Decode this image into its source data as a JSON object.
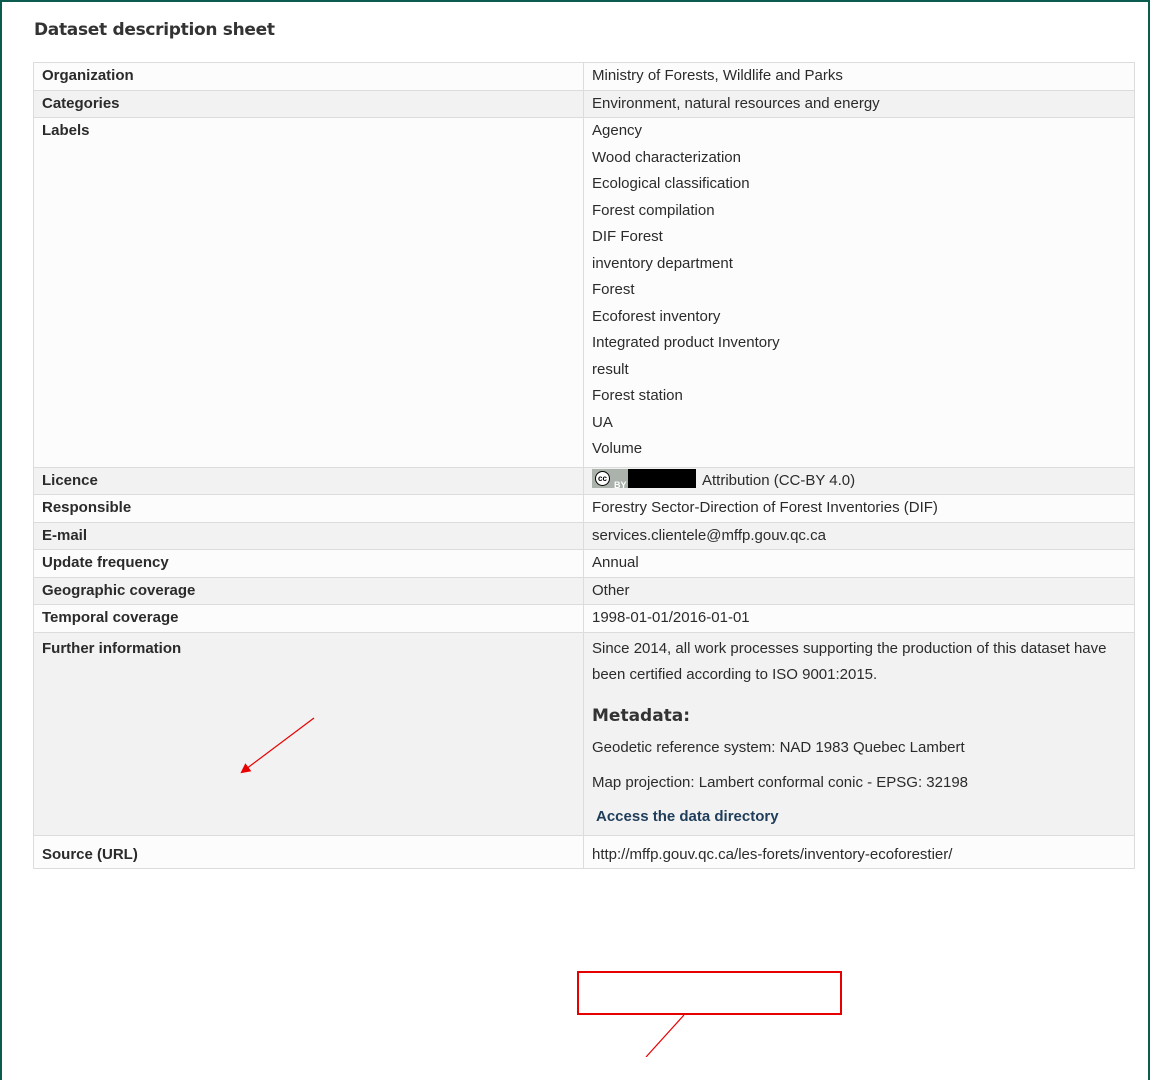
{
  "page": {
    "heading": "Dataset description sheet"
  },
  "rows": {
    "organization": {
      "key": "Organization",
      "value": "Ministry of Forests, Wildlife and Parks"
    },
    "categories": {
      "key": "Categories",
      "value": "Environment, natural resources and energy"
    },
    "labels": {
      "key": "Labels",
      "items": [
        "Agency",
        "Wood characterization",
        "Ecological classification",
        "Forest compilation",
        "DIF Forest",
        "inventory department",
        "Forest",
        "Ecoforest inventory",
        "Integrated product Inventory",
        "result",
        "Forest station",
        "UA",
        "Volume"
      ]
    },
    "licence": {
      "key": "Licence",
      "value": "Attribution (CC-BY 4.0)",
      "badge_text": "cc BY"
    },
    "responsible": {
      "key": "Responsible",
      "value": "Forestry Sector-Direction of Forest Inventories (DIF)"
    },
    "email": {
      "key": "E-mail",
      "value": "services.clientele@mffp.gouv.qc.ca"
    },
    "update": {
      "key": "Update frequency",
      "value": "Annual"
    },
    "geo": {
      "key": "Geographic coverage",
      "value": "Other"
    },
    "temporal": {
      "key": "Temporal coverage",
      "value": "1998-01-01/2016-01-01"
    },
    "further": {
      "key": "Further information",
      "text": "Since 2014, all work processes supporting the production of this dataset have been certified according to ISO 9001:2015.",
      "metadata_heading": "Metadata:",
      "geodetic": "Geodetic reference system: NAD 1983 Quebec Lambert",
      "projection": "Map projection: Lambert conformal conic - EPSG: 32198",
      "link_text": "Access the data directory"
    },
    "source": {
      "key": "Source (URL)",
      "value": "http://mffp.gouv.qc.ca/les-forets/inventory-ecoforestier/"
    }
  },
  "colors": {
    "frame_border": "#0b5b4e",
    "annotation": "#e60000",
    "row_alt": "#f2f2f2"
  }
}
